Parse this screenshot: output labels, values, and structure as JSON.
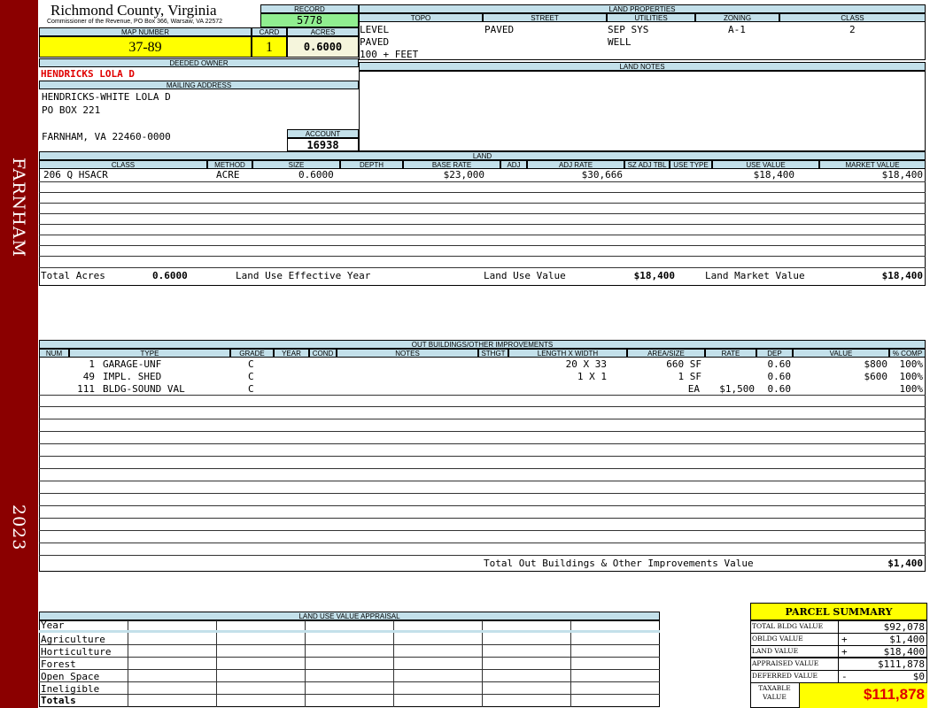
{
  "sidebar": {
    "district": "FARNHAM",
    "year": "2023"
  },
  "header": {
    "title": "Richmond County, Virginia",
    "subtitle": "Commissioner of the Revenue, PO Box 366, Warsaw, VA 22572",
    "record_label": "RECORD",
    "record": "5778",
    "map_number_label": "MAP NUMBER",
    "map_number": "37-89",
    "card_label": "CARD",
    "card": "1",
    "acres_label": "ACRES",
    "acres": "0.6000"
  },
  "land_properties": {
    "title": "LAND PROPERTIES",
    "columns": [
      "TOPO",
      "STREET",
      "UTILITIES",
      "ZONING",
      "CLASS"
    ],
    "topo": [
      "LEVEL",
      "PAVED",
      "100 + FEET"
    ],
    "street": [
      "PAVED"
    ],
    "utilities": [
      "SEP SYS",
      "WELL"
    ],
    "zoning": "A-1",
    "class": "2"
  },
  "owner": {
    "deeded_label": "DEEDED OWNER",
    "deeded_owner": "HENDRICKS LOLA D",
    "mailing_label": "MAILING ADDRESS",
    "mailing_lines": [
      "HENDRICKS-WHITE LOLA D",
      "PO BOX 221",
      "",
      "FARNHAM, VA 22460-0000"
    ],
    "account_label": "ACCOUNT",
    "account": "16938"
  },
  "land_notes": {
    "title": "LAND NOTES"
  },
  "land": {
    "title": "LAND",
    "columns": [
      "CLASS",
      "METHOD",
      "SIZE",
      "DEPTH",
      "BASE RATE",
      "ADJ",
      "ADJ RATE",
      "SZ ADJ TBL",
      "USE TYPE",
      "USE VALUE",
      "MARKET VALUE"
    ],
    "rows": [
      {
        "class": "206 Q HSACR",
        "method": "ACRE",
        "size": "0.6000",
        "depth": "",
        "base_rate": "$23,000",
        "adj": "",
        "adj_rate": "$30,666",
        "sz_adj_tbl": "",
        "use_type": "",
        "use_value": "$18,400",
        "market_value": "$18,400"
      }
    ],
    "totals": {
      "total_acres_label": "Total Acres",
      "total_acres": "0.6000",
      "effective_year_label": "Land Use Effective Year",
      "land_use_value_label": "Land Use Value",
      "land_use_value": "$18,400",
      "land_market_value_label": "Land Market Value",
      "land_market_value": "$18,400"
    }
  },
  "outbuildings": {
    "title": "OUT BUILDINGS/OTHER IMPROVEMENTS",
    "columns": [
      "NUM",
      "TYPE",
      "GRADE",
      "YEAR",
      "COND",
      "NOTES",
      "STHGT",
      "LENGTH X WIDTH",
      "AREA/SIZE",
      "RATE",
      "DEP",
      "VALUE",
      "% COMP"
    ],
    "rows": [
      {
        "num": "1",
        "type": "GARAGE-UNF",
        "grade": "C",
        "lxw": "20 X 33",
        "area": "660 SF",
        "rate": "",
        "dep": "0.60",
        "value": "$800",
        "comp": "100%"
      },
      {
        "num": "49",
        "type": "IMPL. SHED",
        "grade": "C",
        "lxw": "1 X 1",
        "area": "1 SF",
        "rate": "",
        "dep": "0.60",
        "value": "$600",
        "comp": "100%"
      },
      {
        "num": "111",
        "type": "BLDG-SOUND VAL",
        "grade": "C",
        "lxw": "",
        "area": "EA",
        "rate": "$1,500",
        "dep": "0.60",
        "value": "",
        "comp": "100%"
      }
    ],
    "total_label": "Total Out Buildings & Other Improvements Value",
    "total_value": "$1,400"
  },
  "land_use_appraisal": {
    "title": "LAND USE VALUE APPRAISAL",
    "rows": [
      "Year",
      "Agriculture",
      "Horticulture",
      "Forest",
      "Open Space",
      "Ineligible",
      "Totals"
    ]
  },
  "parcel_summary": {
    "title": "PARCEL SUMMARY",
    "rows": [
      {
        "label": "TOTAL BLDG VALUE",
        "sign": "",
        "value": "$92,078"
      },
      {
        "label": "OBLDG VALUE",
        "sign": "+",
        "value": "$1,400"
      },
      {
        "label": "LAND VALUE",
        "sign": "+",
        "value": "$18,400"
      },
      {
        "label": "APPRAISED VALUE",
        "sign": "",
        "value": "$111,878"
      },
      {
        "label": "DEFERRED VALUE",
        "sign": "-",
        "value": "$0"
      }
    ],
    "taxable_label_1": "TAXABLE",
    "taxable_label_2": "VALUE",
    "taxable_value": "$111,878"
  }
}
